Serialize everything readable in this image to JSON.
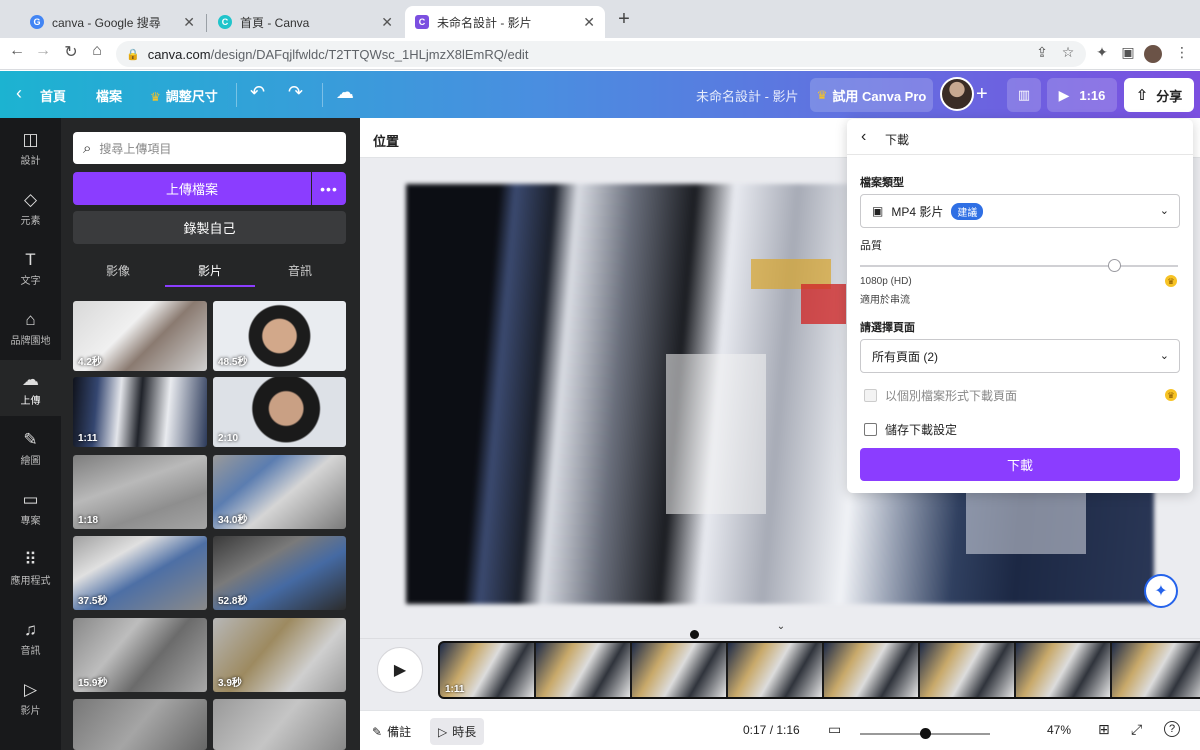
{
  "browser": {
    "tabs": [
      {
        "title": "canva - Google 搜尋",
        "favicon": "G"
      },
      {
        "title": "首頁 - Canva",
        "favicon": "C"
      },
      {
        "title": "未命名設計 - 影片",
        "favicon": "C"
      }
    ],
    "url_domain": "canva.com",
    "url_path": "/design/DAFqjlfwldc/T2TTQWsc_1HLjmzX8lEmRQ/edit"
  },
  "topbar": {
    "home": "首頁",
    "file": "檔案",
    "resize": "調整尺寸",
    "doc_title": "未命名設計 - 影片",
    "try_pro": "試用 Canva Pro",
    "duration": "1:16",
    "share": "分享"
  },
  "rail": [
    {
      "label": "設計",
      "icon": "layout-icon"
    },
    {
      "label": "元素",
      "icon": "shapes-icon"
    },
    {
      "label": "文字",
      "icon": "text-icon"
    },
    {
      "label": "品牌園地",
      "icon": "brand-icon"
    },
    {
      "label": "上傳",
      "icon": "upload-icon"
    },
    {
      "label": "繪圖",
      "icon": "draw-icon"
    },
    {
      "label": "專案",
      "icon": "folder-icon"
    },
    {
      "label": "應用程式",
      "icon": "apps-icon"
    },
    {
      "label": "音訊",
      "icon": "music-icon"
    },
    {
      "label": "影片",
      "icon": "video-icon"
    }
  ],
  "panel": {
    "search_placeholder": "搜尋上傳項目",
    "upload": "上傳檔案",
    "more": "•••",
    "record": "錄製自己",
    "tabs": [
      "影像",
      "影片",
      "音訊"
    ],
    "thumbs": [
      "4.2秒",
      "48.5秒",
      "1:11",
      "2:10",
      "1:18",
      "34.0秒",
      "37.5秒",
      "52.8秒",
      "15.9秒",
      "3.9秒"
    ]
  },
  "canvas": {
    "position": "位置"
  },
  "download": {
    "title": "下載",
    "file_type_label": "檔案類型",
    "file_type": "MP4 影片",
    "recommended": "建議",
    "quality_label": "品質",
    "quality_value": 0.8,
    "quality_text": "1080p (HD)",
    "quality_sub": "適用於串流",
    "pages_label": "請選擇頁面",
    "pages_value": "所有頁面 (2)",
    "separate_files": "以個別檔案形式下載頁面",
    "save_settings": "儲存下載設定",
    "button": "下載"
  },
  "timeline": {
    "clip_duration": "1:11"
  },
  "footer": {
    "notes": "備註",
    "duration": "時長",
    "time": "0:17 / 1:16",
    "zoom": "47%"
  },
  "colors": {
    "accent": "#8b3dff",
    "badge": "#2f6fe4"
  }
}
